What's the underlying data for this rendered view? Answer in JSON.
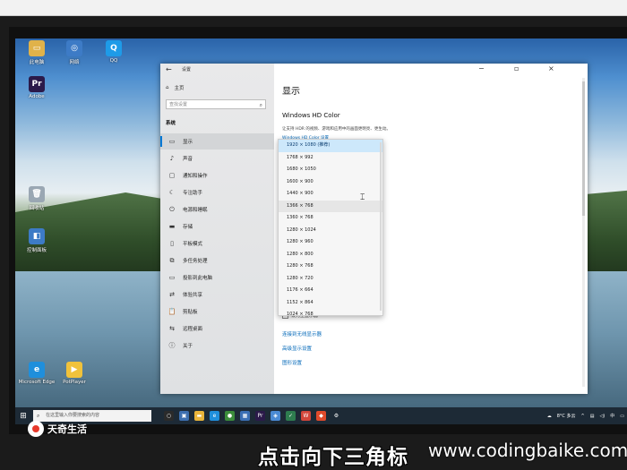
{
  "settings": {
    "app_title": "设置",
    "home_label": "主页",
    "search_placeholder": "查找设置",
    "section_heading": "系统",
    "nav_items": [
      {
        "label": "显示",
        "icon": "monitor-icon",
        "glyph": "▭"
      },
      {
        "label": "声音",
        "icon": "speaker-icon",
        "glyph": "♪"
      },
      {
        "label": "通知和操作",
        "icon": "notification-icon",
        "glyph": "▢"
      },
      {
        "label": "专注助手",
        "icon": "moon-icon",
        "glyph": "☾"
      },
      {
        "label": "电源和睡眠",
        "icon": "power-icon",
        "glyph": "⏻"
      },
      {
        "label": "存储",
        "icon": "storage-icon",
        "glyph": "▬"
      },
      {
        "label": "平板模式",
        "icon": "tablet-icon",
        "glyph": "▯"
      },
      {
        "label": "多任务处理",
        "icon": "multitask-icon",
        "glyph": "⧉"
      },
      {
        "label": "投影到此电脑",
        "icon": "projector-icon",
        "glyph": "▭"
      },
      {
        "label": "体验共享",
        "icon": "share-icon",
        "glyph": "⇄"
      },
      {
        "label": "剪贴板",
        "icon": "clipboard-icon",
        "glyph": "📋"
      },
      {
        "label": "远程桌面",
        "icon": "remote-icon",
        "glyph": "⇆"
      },
      {
        "label": "关于",
        "icon": "info-icon",
        "glyph": "ⓘ"
      }
    ],
    "page_title": "显示",
    "hd_title": "Windows HD Color",
    "hd_desc": "让支持 HDR 的视频、游戏和应用中的画面更明亮、更生动。",
    "hd_link": "Windows HD Color 设置",
    "multi_display_checkbox": "设为主显示器",
    "links": [
      "连接到无线显示器",
      "高级显示设置",
      "图形设置"
    ]
  },
  "resolution_options": [
    "1920 × 1080 (推荐)",
    "1768 × 992",
    "1680 × 1050",
    "1600 × 900",
    "1440 × 900",
    "1366 × 768",
    "1360 × 768",
    "1280 × 1024",
    "1280 × 960",
    "1280 × 800",
    "1280 × 768",
    "1280 × 720",
    "1176 × 664",
    "1152 × 864",
    "1024 × 768"
  ],
  "desktop_icons": [
    {
      "label": "此电脑",
      "color": "#e0b24a",
      "glyph": "▭"
    },
    {
      "label": "网络",
      "color": "#3d7bc6",
      "glyph": "◎"
    },
    {
      "label": "回收站",
      "color": "#9aa7b3",
      "glyph": "🗑"
    },
    {
      "label": "控制面板",
      "color": "#3d7bc6",
      "glyph": "◧"
    },
    {
      "label": "Adobe",
      "color": "#2b1a4a",
      "glyph": "Pr"
    },
    {
      "label": "Microsoft Edge",
      "color": "#1f8fdc",
      "glyph": "e"
    },
    {
      "label": "PotPlayer",
      "color": "#f0c23b",
      "glyph": "▶"
    },
    {
      "label": "QQ",
      "color": "#1e9be8",
      "glyph": "Q"
    }
  ],
  "taskbar": {
    "search_placeholder": "在这里输入你要搜索的内容",
    "tray_temp": "8°C 多云",
    "tray_lang": "中"
  },
  "overlay": {
    "logo_text": "天奇生活",
    "caption": "点击向下三角标",
    "watermark": "www.codingbaike.com"
  }
}
